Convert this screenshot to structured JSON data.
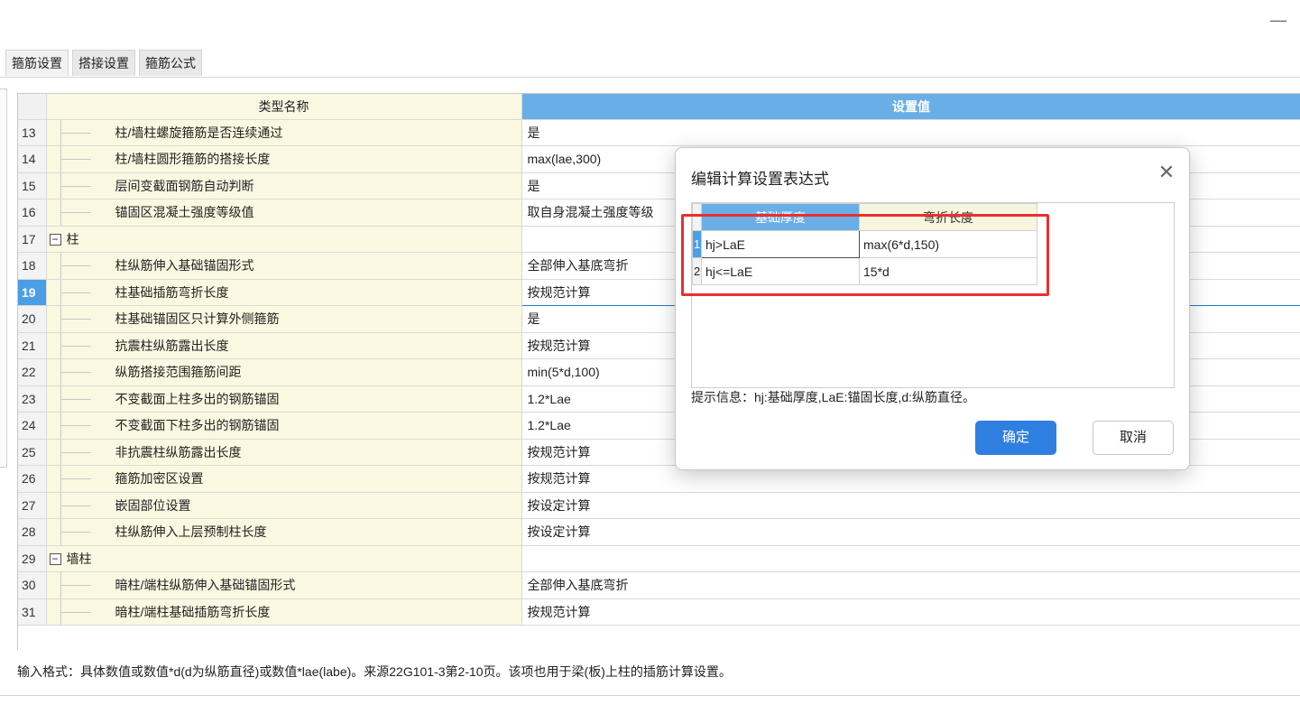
{
  "window": {
    "minimize_glyph": "—"
  },
  "tabs": [
    {
      "label": "箍筋设置"
    },
    {
      "label": "搭接设置"
    },
    {
      "label": "箍筋公式"
    }
  ],
  "grid": {
    "header_name": "类型名称",
    "header_value": "设置值",
    "selected_row": "19",
    "rows": [
      {
        "num": "13",
        "name": "柱/墙柱螺旋箍筋是否连续通过",
        "value": "是"
      },
      {
        "num": "14",
        "name": "柱/墙柱圆形箍筋的搭接长度",
        "value": "max(lae,300)"
      },
      {
        "num": "15",
        "name": "层间变截面钢筋自动判断",
        "value": "是"
      },
      {
        "num": "16",
        "name": "锚固区混凝土强度等级值",
        "value": "取自身混凝土强度等级"
      },
      {
        "num": "17",
        "name": "柱",
        "group": true,
        "value": ""
      },
      {
        "num": "18",
        "name": "柱纵筋伸入基础锚固形式",
        "value": "全部伸入基底弯折"
      },
      {
        "num": "19",
        "name": "柱基础插筋弯折长度",
        "value": "按规范计算"
      },
      {
        "num": "20",
        "name": "柱基础锚固区只计算外侧箍筋",
        "value": "是"
      },
      {
        "num": "21",
        "name": "抗震柱纵筋露出长度",
        "value": "按规范计算"
      },
      {
        "num": "22",
        "name": "纵筋搭接范围箍筋间距",
        "value": "min(5*d,100)"
      },
      {
        "num": "23",
        "name": "不变截面上柱多出的钢筋锚固",
        "value": "1.2*Lae"
      },
      {
        "num": "24",
        "name": "不变截面下柱多出的钢筋锚固",
        "value": "1.2*Lae"
      },
      {
        "num": "25",
        "name": "非抗震柱纵筋露出长度",
        "value": "按规范计算"
      },
      {
        "num": "26",
        "name": "箍筋加密区设置",
        "value": "按规范计算"
      },
      {
        "num": "27",
        "name": "嵌固部位设置",
        "value": "按设定计算"
      },
      {
        "num": "28",
        "name": "柱纵筋伸入上层预制柱长度",
        "value": "按设定计算"
      },
      {
        "num": "29",
        "name": "墙柱",
        "group": true,
        "value": ""
      },
      {
        "num": "30",
        "name": "暗柱/端柱纵筋伸入基础锚固形式",
        "value": "全部伸入基底弯折"
      },
      {
        "num": "31",
        "name": "暗柱/端柱基础插筋弯折长度",
        "value": "按规范计算"
      }
    ],
    "group_toggle": "−"
  },
  "bottom_hint": "输入格式：具体数值或数值*d(d为纵筋直径)或数值*lae(labe)。来源22G101-3第2-10页。该项也用于梁(板)上柱的插筋计算设置。",
  "dialog": {
    "title": "编辑计算设置表达式",
    "close_glyph": "✕",
    "col1": "基础厚度",
    "col2": "弯折长度",
    "rows": [
      {
        "num": "1",
        "condition": "hj>LaE",
        "length": "max(6*d,150)"
      },
      {
        "num": "2",
        "condition": "hj<=LaE",
        "length": "15*d"
      }
    ],
    "hint": "提示信息：hj:基础厚度,LaE:锚固长度,d:纵筋直径。",
    "ok_label": "确定",
    "cancel_label": "取消"
  },
  "colors": {
    "accent": "#2f7fe0",
    "header_blue": "#6aaee8",
    "highlight_red": "#e83030",
    "name_bg": "#fbf8e1"
  }
}
